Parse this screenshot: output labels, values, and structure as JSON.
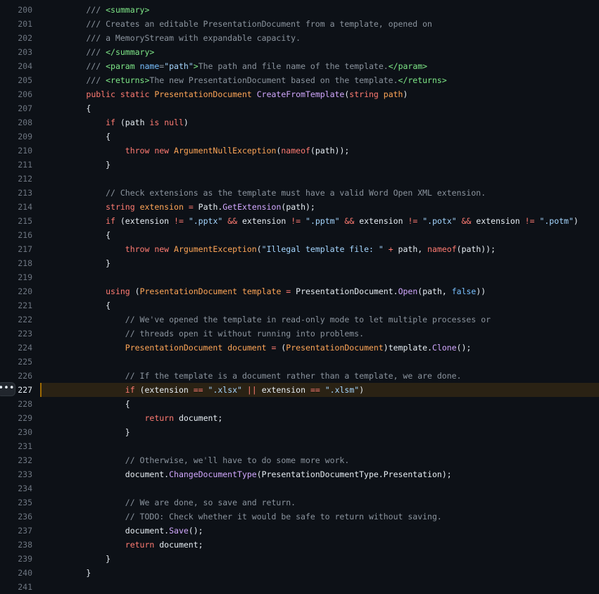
{
  "theme_colors": {
    "background": "#0d1117",
    "comment": "#8b949e",
    "keyword": "#ff7b72",
    "type": "#ffa657",
    "function": "#d2a8ff",
    "string": "#a5d6ff",
    "tag": "#7ee787",
    "highlight_bg": "#2a2214"
  },
  "line_menu": {
    "icon": "kebab-horizontal-icon",
    "label": "•••"
  },
  "highlighted_line": 227,
  "lines": [
    {
      "n": "200",
      "tokens": [
        [
          "c",
          "        /// "
        ],
        [
          "g",
          "<summary>"
        ]
      ]
    },
    {
      "n": "201",
      "tokens": [
        [
          "c",
          "        /// Creates an editable PresentationDocument from a template, opened on"
        ]
      ]
    },
    {
      "n": "202",
      "tokens": [
        [
          "c",
          "        /// a MemoryStream with expandable capacity."
        ]
      ]
    },
    {
      "n": "203",
      "tokens": [
        [
          "c",
          "        /// "
        ],
        [
          "g",
          "</summary>"
        ]
      ]
    },
    {
      "n": "204",
      "tokens": [
        [
          "c",
          "        /// "
        ],
        [
          "g",
          "<param "
        ],
        [
          "a",
          "name"
        ],
        [
          "c",
          "="
        ],
        [
          "s",
          "\"path\""
        ],
        [
          "g",
          ">"
        ],
        [
          "c",
          "The path and file name of the template."
        ],
        [
          "g",
          "</param>"
        ]
      ]
    },
    {
      "n": "205",
      "tokens": [
        [
          "c",
          "        /// "
        ],
        [
          "g",
          "<returns>"
        ],
        [
          "c",
          "The new PresentationDocument based on the template."
        ],
        [
          "g",
          "</returns>"
        ]
      ]
    },
    {
      "n": "206",
      "tokens": [
        [
          "p",
          "        "
        ],
        [
          "k",
          "public static "
        ],
        [
          "t",
          "PresentationDocument "
        ],
        [
          "f",
          "CreateFromTemplate"
        ],
        [
          "p",
          "("
        ],
        [
          "k",
          "string "
        ],
        [
          "t",
          "path"
        ],
        [
          "p",
          ")"
        ]
      ]
    },
    {
      "n": "207",
      "tokens": [
        [
          "p",
          "        {"
        ]
      ]
    },
    {
      "n": "208",
      "tokens": [
        [
          "p",
          "            "
        ],
        [
          "k",
          "if "
        ],
        [
          "p",
          "(path "
        ],
        [
          "k",
          "is null"
        ],
        [
          "p",
          ")"
        ]
      ]
    },
    {
      "n": "209",
      "tokens": [
        [
          "p",
          "            {"
        ]
      ]
    },
    {
      "n": "210",
      "tokens": [
        [
          "p",
          "                "
        ],
        [
          "k",
          "throw new "
        ],
        [
          "t",
          "ArgumentNullException"
        ],
        [
          "p",
          "("
        ],
        [
          "k",
          "nameof"
        ],
        [
          "p",
          "(path));"
        ]
      ]
    },
    {
      "n": "211",
      "tokens": [
        [
          "p",
          "            }"
        ]
      ]
    },
    {
      "n": "212",
      "tokens": []
    },
    {
      "n": "213",
      "tokens": [
        [
          "c",
          "            // Check extensions as the template must have a valid Word Open XML extension."
        ]
      ]
    },
    {
      "n": "214",
      "tokens": [
        [
          "p",
          "            "
        ],
        [
          "k",
          "string "
        ],
        [
          "t",
          "extension "
        ],
        [
          "k",
          "= "
        ],
        [
          "p",
          "Path."
        ],
        [
          "f",
          "GetExtension"
        ],
        [
          "p",
          "(path);"
        ]
      ]
    },
    {
      "n": "215",
      "tokens": [
        [
          "p",
          "            "
        ],
        [
          "k",
          "if "
        ],
        [
          "p",
          "(extension "
        ],
        [
          "k",
          "!= "
        ],
        [
          "s",
          "\".pptx\" "
        ],
        [
          "k",
          "&& "
        ],
        [
          "p",
          "extension "
        ],
        [
          "k",
          "!= "
        ],
        [
          "s",
          "\".pptm\" "
        ],
        [
          "k",
          "&& "
        ],
        [
          "p",
          "extension "
        ],
        [
          "k",
          "!= "
        ],
        [
          "s",
          "\".potx\" "
        ],
        [
          "k",
          "&& "
        ],
        [
          "p",
          "extension "
        ],
        [
          "k",
          "!= "
        ],
        [
          "s",
          "\".potm\""
        ],
        [
          "p",
          ")"
        ]
      ]
    },
    {
      "n": "216",
      "tokens": [
        [
          "p",
          "            {"
        ]
      ]
    },
    {
      "n": "217",
      "tokens": [
        [
          "p",
          "                "
        ],
        [
          "k",
          "throw new "
        ],
        [
          "t",
          "ArgumentException"
        ],
        [
          "p",
          "("
        ],
        [
          "s",
          "\"Illegal template file: \" "
        ],
        [
          "k",
          "+ "
        ],
        [
          "p",
          "path, "
        ],
        [
          "k",
          "nameof"
        ],
        [
          "p",
          "(path));"
        ]
      ]
    },
    {
      "n": "218",
      "tokens": [
        [
          "p",
          "            }"
        ]
      ]
    },
    {
      "n": "219",
      "tokens": []
    },
    {
      "n": "220",
      "tokens": [
        [
          "p",
          "            "
        ],
        [
          "k",
          "using "
        ],
        [
          "p",
          "("
        ],
        [
          "t",
          "PresentationDocument "
        ],
        [
          "t",
          "template "
        ],
        [
          "k",
          "= "
        ],
        [
          "p",
          "PresentationDocument."
        ],
        [
          "f",
          "Open"
        ],
        [
          "p",
          "(path, "
        ],
        [
          "x",
          "false"
        ],
        [
          "p",
          "))"
        ]
      ]
    },
    {
      "n": "221",
      "tokens": [
        [
          "p",
          "            {"
        ]
      ]
    },
    {
      "n": "222",
      "tokens": [
        [
          "c",
          "                // We've opened the template in read-only mode to let multiple processes or"
        ]
      ]
    },
    {
      "n": "223",
      "tokens": [
        [
          "c",
          "                // threads open it without running into problems."
        ]
      ]
    },
    {
      "n": "224",
      "tokens": [
        [
          "p",
          "                "
        ],
        [
          "t",
          "PresentationDocument "
        ],
        [
          "t",
          "document "
        ],
        [
          "k",
          "= "
        ],
        [
          "p",
          "("
        ],
        [
          "t",
          "PresentationDocument"
        ],
        [
          "p",
          ")template."
        ],
        [
          "f",
          "Clone"
        ],
        [
          "p",
          "();"
        ]
      ]
    },
    {
      "n": "225",
      "tokens": []
    },
    {
      "n": "226",
      "tokens": [
        [
          "c",
          "                // If the template is a document rather than a template, we are done."
        ]
      ]
    },
    {
      "n": "227",
      "tokens": [
        [
          "p",
          "                "
        ],
        [
          "k",
          "if "
        ],
        [
          "p",
          "(extension "
        ],
        [
          "k",
          "== "
        ],
        [
          "s",
          "\".xlsx\" "
        ],
        [
          "k",
          "|| "
        ],
        [
          "p",
          "extension "
        ],
        [
          "k",
          "== "
        ],
        [
          "s",
          "\".xlsm\""
        ],
        [
          "p",
          ")"
        ]
      ]
    },
    {
      "n": "228",
      "tokens": [
        [
          "p",
          "                {"
        ]
      ]
    },
    {
      "n": "229",
      "tokens": [
        [
          "p",
          "                    "
        ],
        [
          "k",
          "return "
        ],
        [
          "p",
          "document;"
        ]
      ]
    },
    {
      "n": "230",
      "tokens": [
        [
          "p",
          "                }"
        ]
      ]
    },
    {
      "n": "231",
      "tokens": []
    },
    {
      "n": "232",
      "tokens": [
        [
          "c",
          "                // Otherwise, we'll have to do some more work."
        ]
      ]
    },
    {
      "n": "233",
      "tokens": [
        [
          "p",
          "                document."
        ],
        [
          "f",
          "ChangeDocumentType"
        ],
        [
          "p",
          "(PresentationDocumentType.Presentation);"
        ]
      ]
    },
    {
      "n": "234",
      "tokens": []
    },
    {
      "n": "235",
      "tokens": [
        [
          "c",
          "                // We are done, so save and return."
        ]
      ]
    },
    {
      "n": "236",
      "tokens": [
        [
          "c",
          "                // TODO: Check whether it would be safe to return without saving."
        ]
      ]
    },
    {
      "n": "237",
      "tokens": [
        [
          "p",
          "                document."
        ],
        [
          "f",
          "Save"
        ],
        [
          "p",
          "();"
        ]
      ]
    },
    {
      "n": "238",
      "tokens": [
        [
          "p",
          "                "
        ],
        [
          "k",
          "return "
        ],
        [
          "p",
          "document;"
        ]
      ]
    },
    {
      "n": "239",
      "tokens": [
        [
          "p",
          "            }"
        ]
      ]
    },
    {
      "n": "240",
      "tokens": [
        [
          "p",
          "        }"
        ]
      ]
    },
    {
      "n": "241",
      "tokens": []
    }
  ]
}
